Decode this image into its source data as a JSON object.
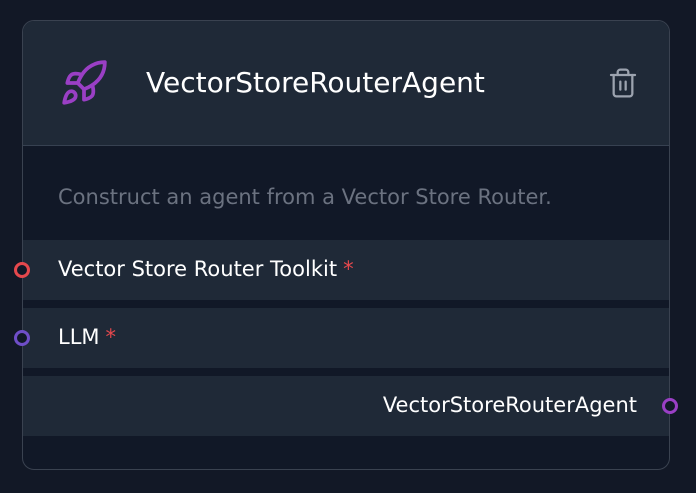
{
  "node": {
    "title": "VectorStoreRouterAgent",
    "icon": "rocket-icon",
    "accent_color": "#9a3fc5",
    "delete_icon": "trash-icon",
    "description": "Construct an agent from a Vector Store Router.",
    "inputs": [
      {
        "label": "Vector Store Router Toolkit",
        "required_marker": "*",
        "handle_color": "#e5484d"
      },
      {
        "label": "LLM",
        "required_marker": "*",
        "handle_color": "#6f4ec8"
      }
    ],
    "output": {
      "label": "VectorStoreRouterAgent",
      "handle_color": "#9a3fc5"
    }
  }
}
